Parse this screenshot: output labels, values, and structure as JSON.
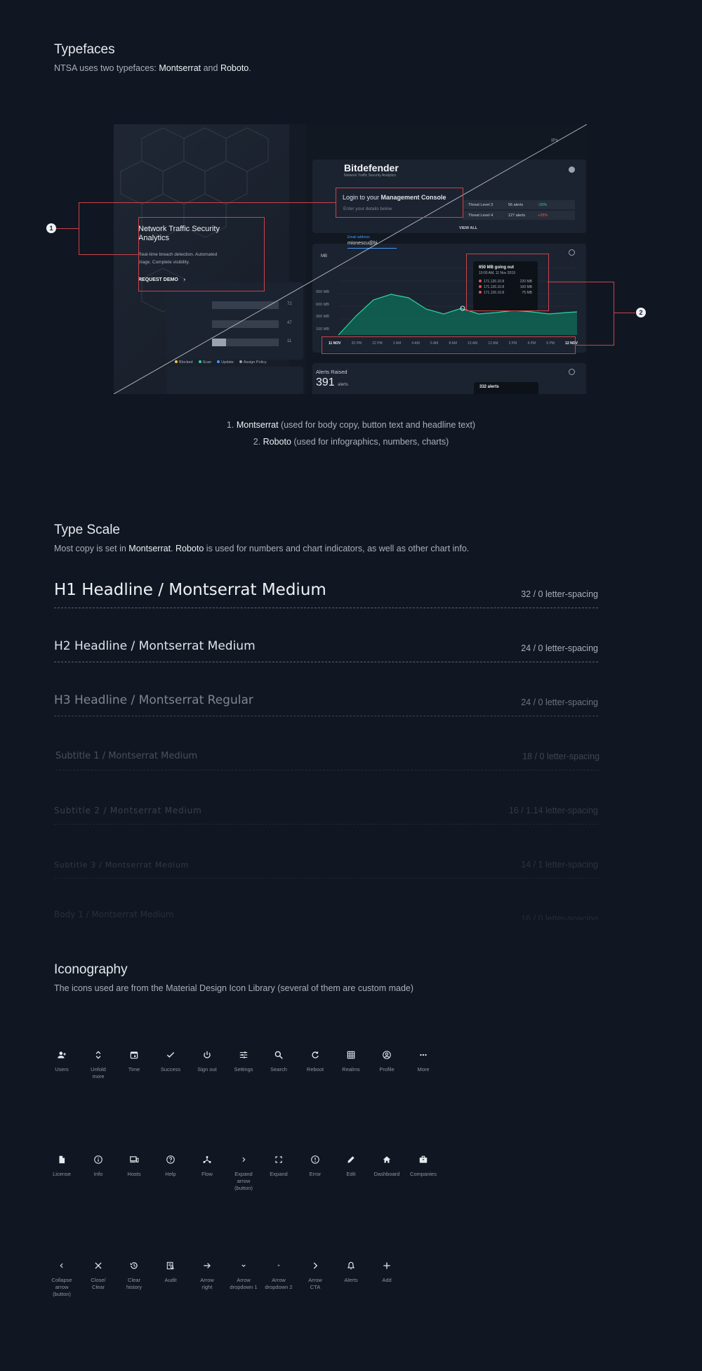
{
  "typefaces": {
    "title": "Typefaces",
    "desc_pre": "NTSA uses two typefaces: ",
    "font1": "Montserrat",
    "desc_mid": " and ",
    "font2": "Roboto",
    "desc_post": "."
  },
  "mockup": {
    "brand": "Bitdefender",
    "brand_sub": "Network Traffic Security Analytics",
    "login_pre": "Login to your ",
    "login_bold": "Management Console",
    "login_hint": "Enter your details below",
    "email_label": "Email address",
    "email_value": "mionescu@bi",
    "hero_title": "Network Traffic Security Analytics",
    "hero_desc": "Real-time breach detection. Automated triage. Complete visibility.",
    "hero_cta": "REQUEST DEMO",
    "threats": [
      {
        "name": "Threat Level 3",
        "alerts": "56 alerts",
        "change": "-15%",
        "color": "#2bd6a2"
      },
      {
        "name": "Threat Level 4",
        "alerts": "127 alerts",
        "change": "+28%",
        "color": "#e8505b"
      }
    ],
    "view_all": "VIEW ALL",
    "ips_label": "IPs",
    "chart_unit": "MB",
    "chart_y": [
      "900 MB",
      "600 MB",
      "300 MB",
      "100 MB"
    ],
    "chart_x": [
      "11 NOV",
      "20 PM",
      "22 PM",
      "2 AM",
      "4 AM",
      "6 AM",
      "8 AM",
      "10 AM",
      "12 AM",
      "2 PM",
      "4 PM",
      "6 PM",
      "12 NOV"
    ],
    "tooltip_title": "650 MB going out",
    "tooltip_time": "10:00 AM, 11 Nov 2019",
    "tooltip_rows": [
      {
        "ip": "171.126.10.8",
        "val": "220 MB"
      },
      {
        "ip": "171.126.10.8",
        "val": "100 MB"
      },
      {
        "ip": "171.126.10.8",
        "val": "75 MB"
      }
    ],
    "bars_values": [
      "72",
      "47",
      "11"
    ],
    "legend": [
      {
        "label": "Blocked",
        "color": "#f4c542"
      },
      {
        "label": "Scan",
        "color": "#2bd6a2"
      },
      {
        "label": "Update",
        "color": "#3d9bff"
      },
      {
        "label": "Assign Policy",
        "color": "#9aa3af"
      }
    ],
    "alerts_title": "Alerts Raised",
    "alerts_count": "391",
    "alerts_unit": "alerts",
    "alerts_tip": "332 alerts",
    "marker1": "1",
    "marker2": "2"
  },
  "notes": {
    "line1_pre": "1. ",
    "line1_bold": "Montserrat",
    "line1_post": " (used for body copy, button text and headline text)",
    "line2_pre": "2. ",
    "line2_bold": "Roboto",
    "line2_post": " (used for infographics, numbers, charts)"
  },
  "type_scale": {
    "title": "Type Scale",
    "desc_pre": "Most copy is set in ",
    "desc_b1": "Montserrat",
    "desc_mid": ". ",
    "desc_b2": "Roboto",
    "desc_post": " is used for numbers and chart indicators, as well as other chart info.",
    "rows": [
      {
        "name": "H1 Headline / Montserrat Medium",
        "spec": "32 / 0 letter-spacing"
      },
      {
        "name": "H2 Headline / Montserrat Medium",
        "spec": "24 / 0 letter-spacing"
      },
      {
        "name": "H3 Headline / Montserrat Regular",
        "spec": "24 / 0 letter-spacing"
      },
      {
        "name": "Subtitle 1 / Montserrat Medium",
        "spec": "18 / 0 letter-spacing"
      },
      {
        "name": "Subtitle 2 / Montserrat Medium",
        "spec": "16 / 1.14 letter-spacing"
      },
      {
        "name": "Subtitle 3 / Montserrat Medium",
        "spec": "14 / 1 letter-spacing"
      },
      {
        "name": "Body 1 / Montserrat Medium",
        "spec": "16 / 0 letter-spacing"
      }
    ]
  },
  "iconography": {
    "title": "Iconography",
    "desc": "The icons used are from the Material Design Icon Library (several of them are custom made)",
    "row1": [
      {
        "label": "Users",
        "icon": "add-user-icon"
      },
      {
        "label": "Unfold more",
        "icon": "unfold-more-icon"
      },
      {
        "label": "Time",
        "icon": "calendar-icon"
      },
      {
        "label": "Success",
        "icon": "check-icon"
      },
      {
        "label": "Sign out",
        "icon": "power-icon"
      },
      {
        "label": "Settings",
        "icon": "tune-icon"
      },
      {
        "label": "Search",
        "icon": "search-icon"
      },
      {
        "label": "Reboot",
        "icon": "refresh-icon"
      },
      {
        "label": "Realms",
        "icon": "grid-icon"
      },
      {
        "label": "Profile",
        "icon": "account-circle-icon"
      },
      {
        "label": "More",
        "icon": "more-horiz-icon"
      }
    ],
    "row2": [
      {
        "label": "License",
        "icon": "file-icon"
      },
      {
        "label": "Info",
        "icon": "info-icon"
      },
      {
        "label": "Hosts",
        "icon": "devices-icon"
      },
      {
        "label": "Help",
        "icon": "help-icon"
      },
      {
        "label": "Flow",
        "icon": "flow-icon"
      },
      {
        "label": "Expand arrow (button)",
        "icon": "chevron-right-icon"
      },
      {
        "label": "Expand",
        "icon": "fullscreen-icon"
      },
      {
        "label": "Error",
        "icon": "error-icon"
      },
      {
        "label": "Edit",
        "icon": "pencil-icon"
      },
      {
        "label": "Dashboard",
        "icon": "home-icon"
      },
      {
        "label": "Companies",
        "icon": "briefcase-icon"
      }
    ],
    "row3": [
      {
        "label": "Collapse arrow (button)",
        "icon": "chevron-left-icon"
      },
      {
        "label": "Close/ Clear",
        "icon": "close-icon"
      },
      {
        "label": "Clear history",
        "icon": "history-icon"
      },
      {
        "label": "Audit",
        "icon": "audit-icon"
      },
      {
        "label": "Arrow right",
        "icon": "arrow-right-icon"
      },
      {
        "label": "Arrow dropdown 1",
        "icon": "chevron-down-icon"
      },
      {
        "label": "Arrow dropdown 2",
        "icon": "caret-down-icon"
      },
      {
        "label": "Arrow CTA",
        "icon": "arrow-cta-icon"
      },
      {
        "label": "Alerts",
        "icon": "bell-icon"
      },
      {
        "label": "Add",
        "icon": "plus-icon"
      }
    ]
  }
}
